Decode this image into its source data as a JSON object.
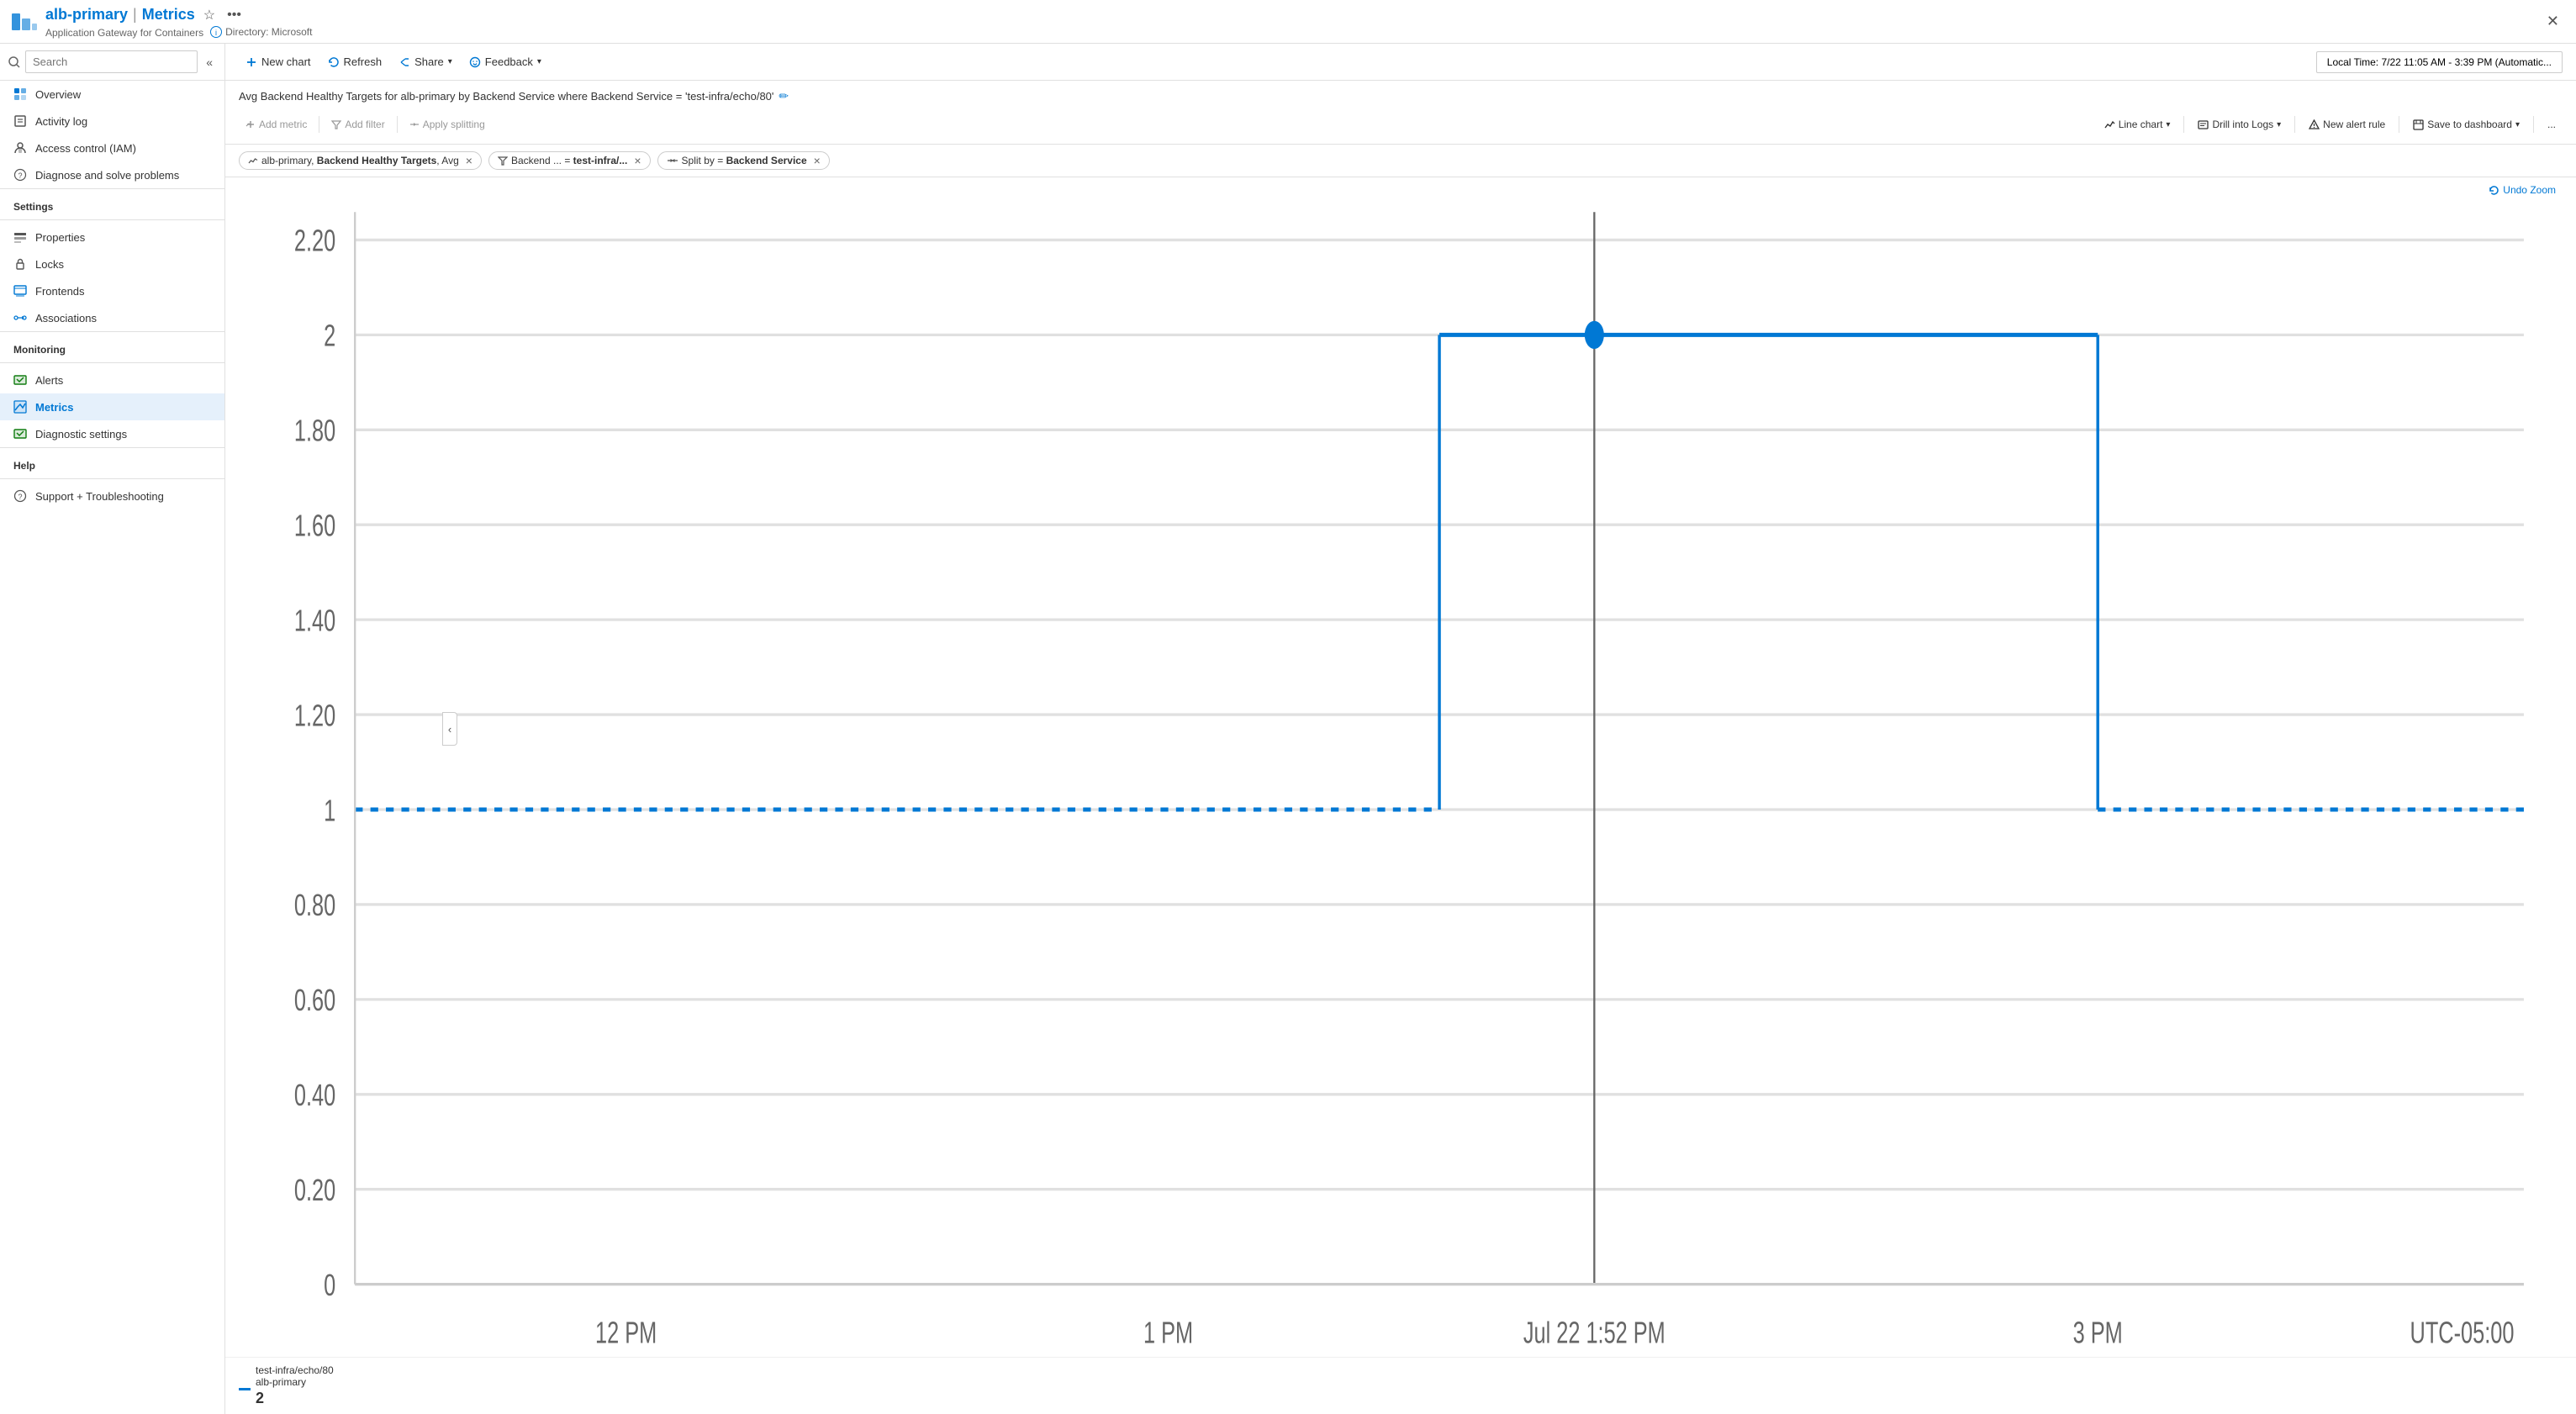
{
  "titleBar": {
    "appName": "alb-primary",
    "separator": "|",
    "pageTitle": "Metrics",
    "subtitle": "Application Gateway for Containers",
    "directory": "Directory: Microsoft",
    "closeLabel": "✕"
  },
  "toolbar": {
    "newChart": "New chart",
    "refresh": "Refresh",
    "share": "Share",
    "feedback": "Feedback",
    "timeRange": "Local Time: 7/22 11:05 AM - 3:39 PM (Automatic..."
  },
  "chartHeader": {
    "title": "Avg Backend Healthy Targets for alb-primary by Backend Service where Backend Service = 'test-infra/echo/80'",
    "editIcon": "✏️"
  },
  "chartControls": {
    "addMetric": "Add metric",
    "addFilter": "Add filter",
    "applySplitting": "Apply splitting",
    "lineChart": "Line chart",
    "drillIntoLogs": "Drill into Logs",
    "newAlertRule": "New alert rule",
    "saveToDashboard": "Save to dashboard",
    "moreOptions": "..."
  },
  "filterChips": [
    {
      "id": "chip-metric",
      "label": "alb-primary, Backend Healthy Targets, Avg",
      "hasClose": true
    },
    {
      "id": "chip-filter",
      "label": "Backend ... = test-infra/...",
      "prefix": "🔽",
      "hasClose": true
    },
    {
      "id": "chip-split",
      "label": "Split by = Backend Service",
      "prefix": "⇄",
      "hasClose": true
    }
  ],
  "chart": {
    "yLabels": [
      "2.20",
      "2",
      "1.80",
      "1.60",
      "1.40",
      "1.20",
      "1",
      "0.80",
      "0.60",
      "0.40",
      "0.20",
      "0"
    ],
    "xLabels": [
      "12 PM",
      "1 PM",
      "Jul 22 1:52 PM",
      "3 PM"
    ],
    "timezone": "UTC-05:00",
    "undoZoom": "Undo Zoom"
  },
  "legend": {
    "seriesName": "test-infra/echo/80",
    "resourceName": "alb-primary",
    "currentValue": "2"
  },
  "sidebar": {
    "searchPlaceholder": "Search",
    "navItems": [
      {
        "id": "overview",
        "label": "Overview",
        "icon": "overview"
      },
      {
        "id": "activity-log",
        "label": "Activity log",
        "icon": "log"
      },
      {
        "id": "access-control",
        "label": "Access control (IAM)",
        "icon": "iam"
      },
      {
        "id": "diagnose",
        "label": "Diagnose and solve problems",
        "icon": "diagnose"
      }
    ],
    "settingsSection": "Settings",
    "settingsItems": [
      {
        "id": "properties",
        "label": "Properties",
        "icon": "properties"
      },
      {
        "id": "locks",
        "label": "Locks",
        "icon": "locks"
      },
      {
        "id": "frontends",
        "label": "Frontends",
        "icon": "frontends"
      },
      {
        "id": "associations",
        "label": "Associations",
        "icon": "associations"
      }
    ],
    "monitoringSection": "Monitoring",
    "monitoringItems": [
      {
        "id": "alerts",
        "label": "Alerts",
        "icon": "alerts"
      },
      {
        "id": "metrics",
        "label": "Metrics",
        "icon": "metrics",
        "active": true
      },
      {
        "id": "diagnostic-settings",
        "label": "Diagnostic settings",
        "icon": "diagnostic"
      }
    ],
    "helpSection": "Help",
    "helpItems": [
      {
        "id": "support",
        "label": "Support + Troubleshooting",
        "icon": "support"
      }
    ]
  }
}
